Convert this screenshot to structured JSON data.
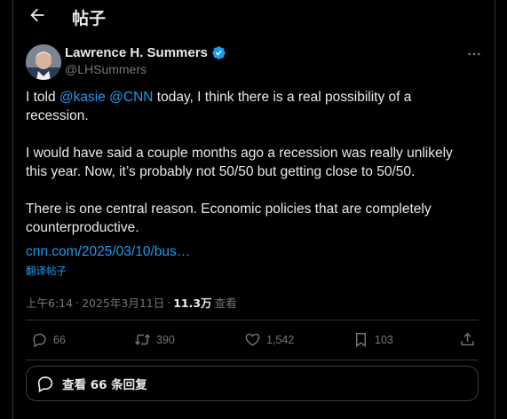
{
  "header": {
    "title": "帖子"
  },
  "author": {
    "name": "Lawrence H. Summers",
    "handle": "@LHSummers",
    "verified_color": "#1d9bf0"
  },
  "tweet": {
    "p1_prefix": "I told ",
    "mention1": "@kasie",
    "space": " ",
    "mention2": "@CNN",
    "p1_suffix": " today, I think there is a real possibility of a recession.",
    "p2": "I would have said a couple months ago a recession was really unlikely this year. Now, it’s probably not 50/50 but getting close to 50/50.",
    "p3": "There is one central reason. Economic policies that are completely counterproductive.",
    "link": "cnn.com/2025/03/10/bus…",
    "translate": "翻译帖子"
  },
  "meta": {
    "time": "上午6:14",
    "sep": "·",
    "date": "2025年3月11日",
    "views_count": "11.3万",
    "views_label": "查看"
  },
  "actions": {
    "replies": "66",
    "reposts": "390",
    "likes": "1,542",
    "bookmarks": "103"
  },
  "replies_button": {
    "label": "查看 66 条回复"
  },
  "colors": {
    "accent": "#1d9bf0",
    "muted": "#71767b",
    "text": "#e7e9ea",
    "border": "#2f3336"
  }
}
